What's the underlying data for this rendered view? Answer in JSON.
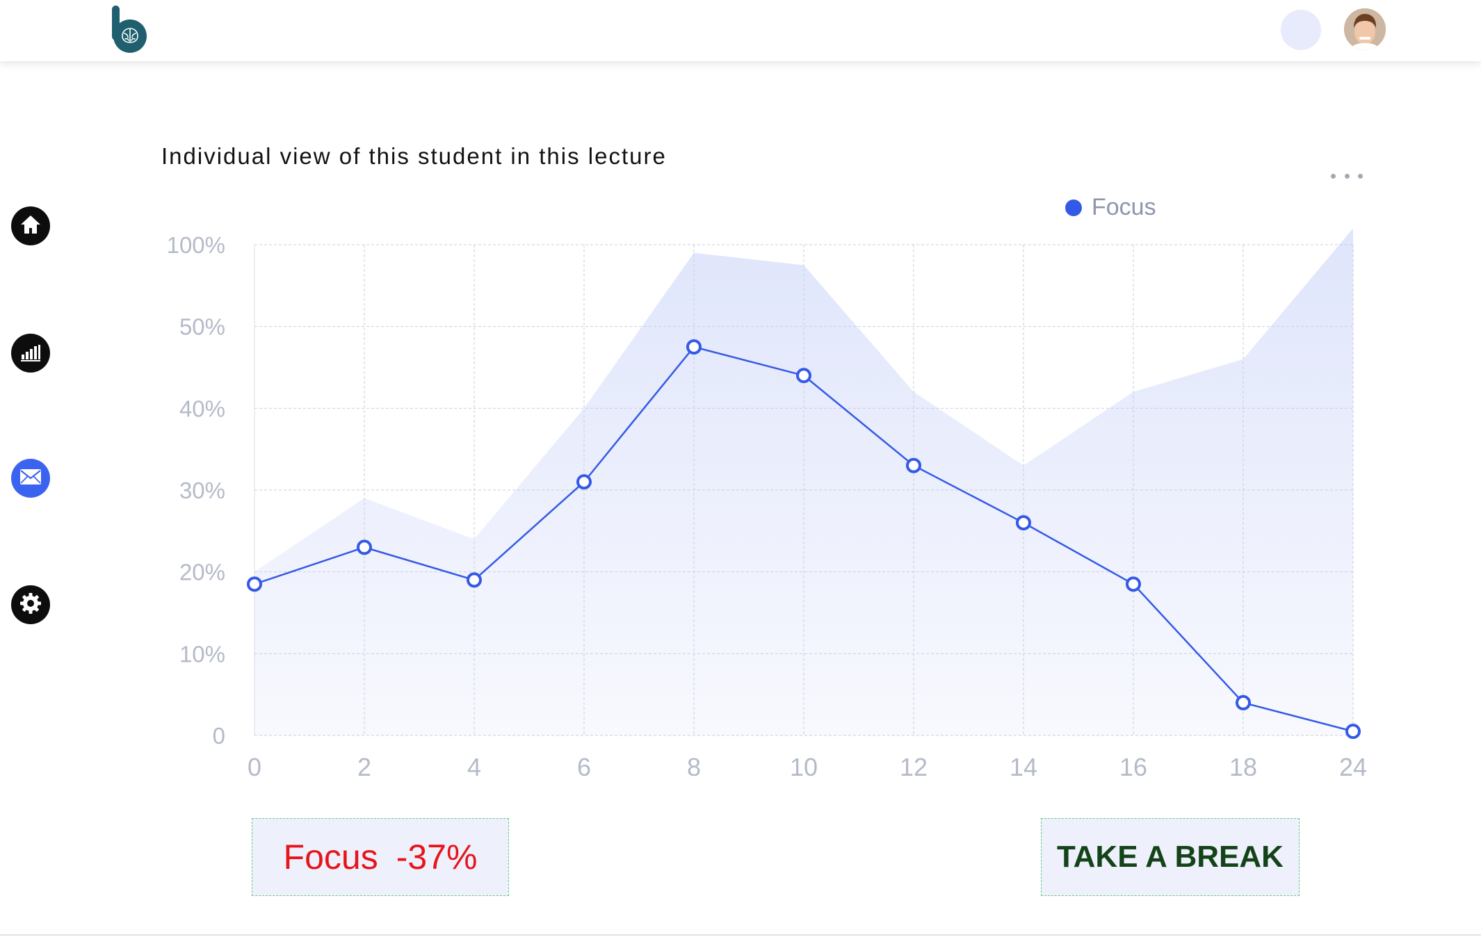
{
  "header": {
    "avatar_alt": "user avatar"
  },
  "sidebar": {
    "items": [
      {
        "id": "home",
        "icon": "home-icon"
      },
      {
        "id": "stats",
        "icon": "bar-chart-icon"
      },
      {
        "id": "messages",
        "icon": "mail-icon"
      },
      {
        "id": "settings",
        "icon": "gear-icon"
      }
    ],
    "active": "messages"
  },
  "chart_data": {
    "type": "line",
    "title": "Individual view of this student in this lecture",
    "x": [
      "0",
      "2",
      "4",
      "6",
      "8",
      "10",
      "12",
      "14",
      "16",
      "18",
      "24"
    ],
    "y_ticks": [
      "0",
      "10%",
      "20%",
      "30%",
      "40%",
      "50%",
      "100%"
    ],
    "series": [
      {
        "name": "Focus",
        "tick_values": [
          1.85,
          2.3,
          1.9,
          3.1,
          4.75,
          4.4,
          3.3,
          2.6,
          1.85,
          0.4,
          0.05
        ],
        "color": "#3459e6"
      }
    ],
    "band": {
      "tick_values": [
        2.0,
        2.9,
        2.4,
        4.0,
        5.9,
        5.75,
        4.2,
        3.3,
        4.2,
        4.6,
        6.2
      ],
      "color": "#e4e9fb"
    },
    "grid": true,
    "legend_position": "top-right"
  },
  "summary": {
    "focus_label": "Focus",
    "focus_change": "-37%"
  },
  "actions": {
    "break_label": "TAKE A BREAK"
  },
  "colors": {
    "accent": "#3a63f0",
    "line": "#3459e6",
    "band": "#e4e9fb",
    "negative": "#e8141b",
    "brand": "#1f5f6e"
  }
}
